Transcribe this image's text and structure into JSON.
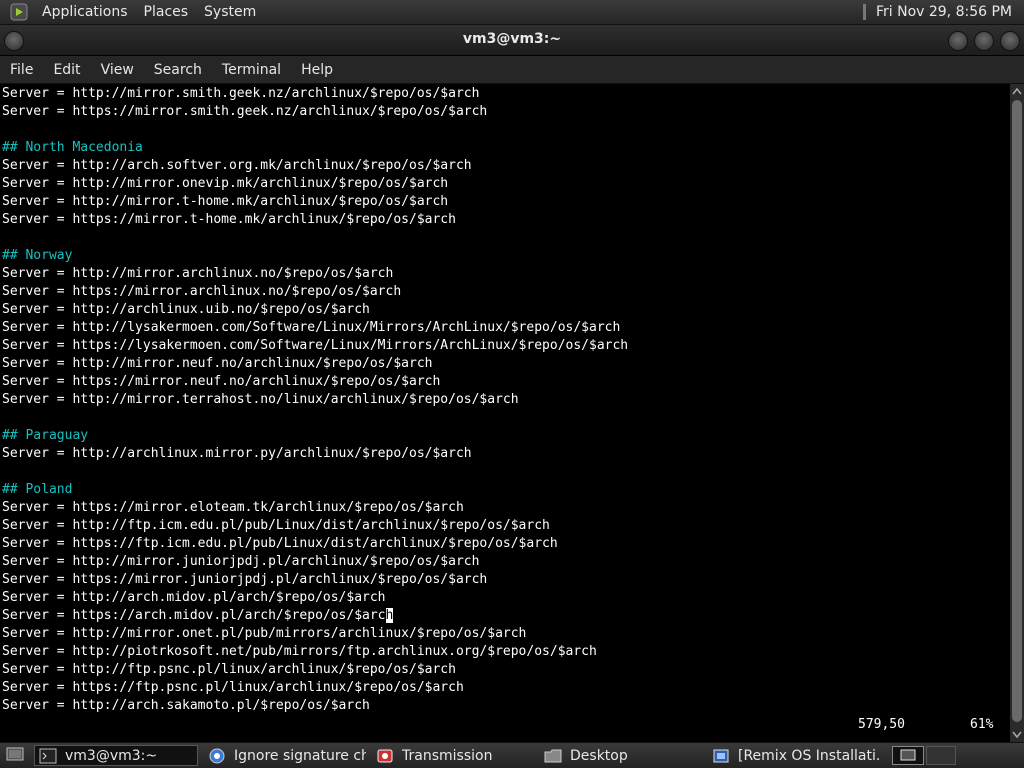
{
  "top_panel": {
    "menus": [
      "Applications",
      "Places",
      "System"
    ],
    "datetime": "Fri Nov 29,  8:56 PM"
  },
  "window": {
    "title": "vm3@vm3:~"
  },
  "menubar": {
    "items": [
      "File",
      "Edit",
      "View",
      "Search",
      "Terminal",
      "Help"
    ]
  },
  "terminal": {
    "lines": [
      "Server = http://mirror.smith.geek.nz/archlinux/$repo/os/$arch",
      "Server = https://mirror.smith.geek.nz/archlinux/$repo/os/$arch",
      "",
      "## North Macedonia",
      "Server = http://arch.softver.org.mk/archlinux/$repo/os/$arch",
      "Server = http://mirror.onevip.mk/archlinux/$repo/os/$arch",
      "Server = http://mirror.t-home.mk/archlinux/$repo/os/$arch",
      "Server = https://mirror.t-home.mk/archlinux/$repo/os/$arch",
      "",
      "## Norway",
      "Server = http://mirror.archlinux.no/$repo/os/$arch",
      "Server = https://mirror.archlinux.no/$repo/os/$arch",
      "Server = http://archlinux.uib.no/$repo/os/$arch",
      "Server = http://lysakermoen.com/Software/Linux/Mirrors/ArchLinux/$repo/os/$arch",
      "Server = https://lysakermoen.com/Software/Linux/Mirrors/ArchLinux/$repo/os/$arch",
      "Server = http://mirror.neuf.no/archlinux/$repo/os/$arch",
      "Server = https://mirror.neuf.no/archlinux/$repo/os/$arch",
      "Server = http://mirror.terrahost.no/linux/archlinux/$repo/os/$arch",
      "",
      "## Paraguay",
      "Server = http://archlinux.mirror.py/archlinux/$repo/os/$arch",
      "",
      "## Poland",
      "Server = https://mirror.eloteam.tk/archlinux/$repo/os/$arch",
      "Server = http://ftp.icm.edu.pl/pub/Linux/dist/archlinux/$repo/os/$arch",
      "Server = https://ftp.icm.edu.pl/pub/Linux/dist/archlinux/$repo/os/$arch",
      "Server = http://mirror.juniorjpdj.pl/archlinux/$repo/os/$arch",
      "Server = https://mirror.juniorjpdj.pl/archlinux/$repo/os/$arch",
      "Server = http://arch.midov.pl/arch/$repo/os/$arch",
      "Server = https://arch.midov.pl/arch/$repo/os/$arch",
      "Server = http://mirror.onet.pl/pub/mirrors/archlinux/$repo/os/$arch",
      "Server = http://piotrkosoft.net/pub/mirrors/ftp.archlinux.org/$repo/os/$arch",
      "Server = http://ftp.psnc.pl/linux/archlinux/$repo/os/$arch",
      "Server = https://ftp.psnc.pl/linux/archlinux/$repo/os/$arch",
      "Server = http://arch.sakamoto.pl/$repo/os/$arch"
    ],
    "cursor_line_index": 29,
    "cursor_line_before": "Server = https://arch.midov.pl/arch/$repo/os/$arc",
    "cursor_char": "h",
    "status_position": "579,50",
    "status_percent": "61%"
  },
  "taskbar": {
    "tasks": [
      "vm3@vm3:~",
      "Ignore signature ch...",
      "Transmission",
      "Desktop",
      "[Remix OS Installati..."
    ]
  },
  "colors": {
    "comment": "#19c0c0",
    "text": "#ffffff",
    "background": "#000000"
  }
}
